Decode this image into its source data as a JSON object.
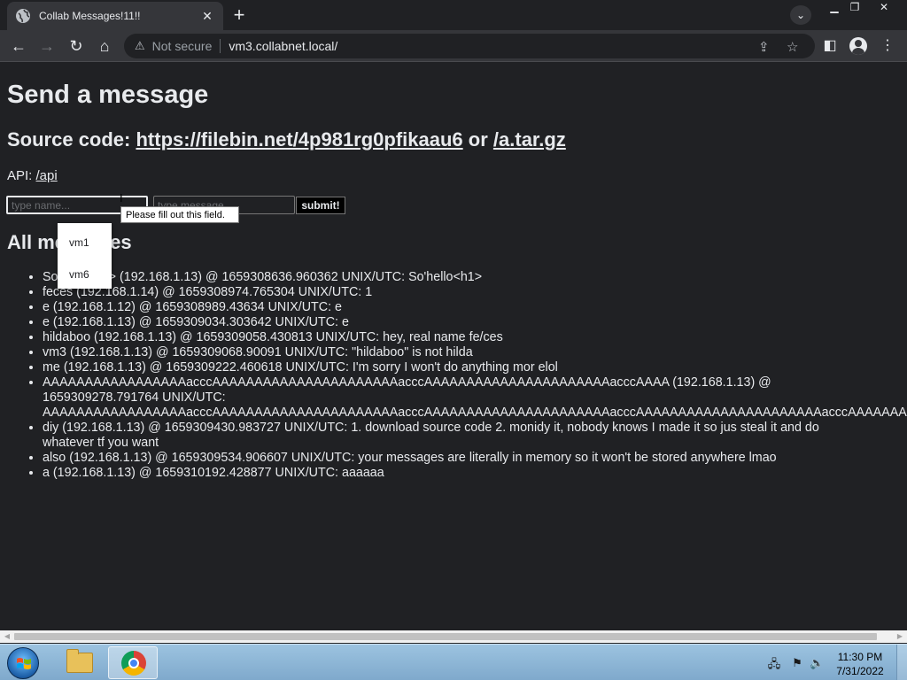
{
  "browser": {
    "tab_title": "Collab Messages!11!!",
    "tab_close": "✕",
    "new_tab": "+",
    "security_label": "Not secure",
    "url": "vm3.collabnet.local/"
  },
  "page": {
    "heading": "Send a message",
    "source_prefix": "Source code: ",
    "source_link": "https://filebin.net/4p981rg0pfikaau6",
    "source_or": " or ",
    "tar_link": "/a.tar.gz",
    "api_prefix": "API: ",
    "api_link": "/api",
    "name_placeholder": "type name...",
    "message_placeholder": "type message...",
    "submit_label": "submit!",
    "messages_heading": "All messages",
    "messages": [
      "So'hello<h1> (192.168.1.13) @ 1659308636.960362 UNIX/UTC: So'hello<h1>",
      "feces (192.168.1.14) @ 1659308974.765304 UNIX/UTC: 1",
      "e (192.168.1.12) @ 1659308989.43634 UNIX/UTC: e",
      "e (192.168.1.13) @ 1659309034.303642 UNIX/UTC: e",
      "hildaboo (192.168.1.13) @ 1659309058.430813 UNIX/UTC: hey, real name fe/ces",
      "vm3 (192.168.1.13) @ 1659309068.90091 UNIX/UTC: \"hildaboo\" is not hilda",
      "me (192.168.1.13) @ 1659309222.460618 UNIX/UTC: I'm sorry I won't do anything mor elol",
      "AAAAAAAAAAAAAAAAAacccAAAAAAAAAAAAAAAAAAAAAAacccAAAAAAAAAAAAAAAAAAAAAAacccAAAA (192.168.1.13) @",
      "1659309278.791764 UNIX/UTC:",
      "AAAAAAAAAAAAAAAAAacccAAAAAAAAAAAAAAAAAAAAAAacccAAAAAAAAAAAAAAAAAAAAAAacccAAAAAAAAAAAAAAAAAAAAAAacccAAAAAAAAAAAAAAAAAAAAAAacccAAAA",
      "diy (192.168.1.13) @ 1659309430.983727 UNIX/UTC: 1. download source code 2. monidy it, nobody knows I made it so jus steal it and do whatever tf you want",
      "also (192.168.1.13) @ 1659309534.906607 UNIX/UTC: your messages are literally in memory so it won't be stored anywhere lmao",
      "a (192.168.1.13) @ 1659310192.428877 UNIX/UTC: aaaaaa"
    ],
    "autocomplete_options": [
      "vm1",
      "vm6"
    ],
    "validation_tooltip": "Please fill out this field."
  },
  "taskbar": {
    "time": "11:30 PM",
    "date": "7/31/2022"
  }
}
